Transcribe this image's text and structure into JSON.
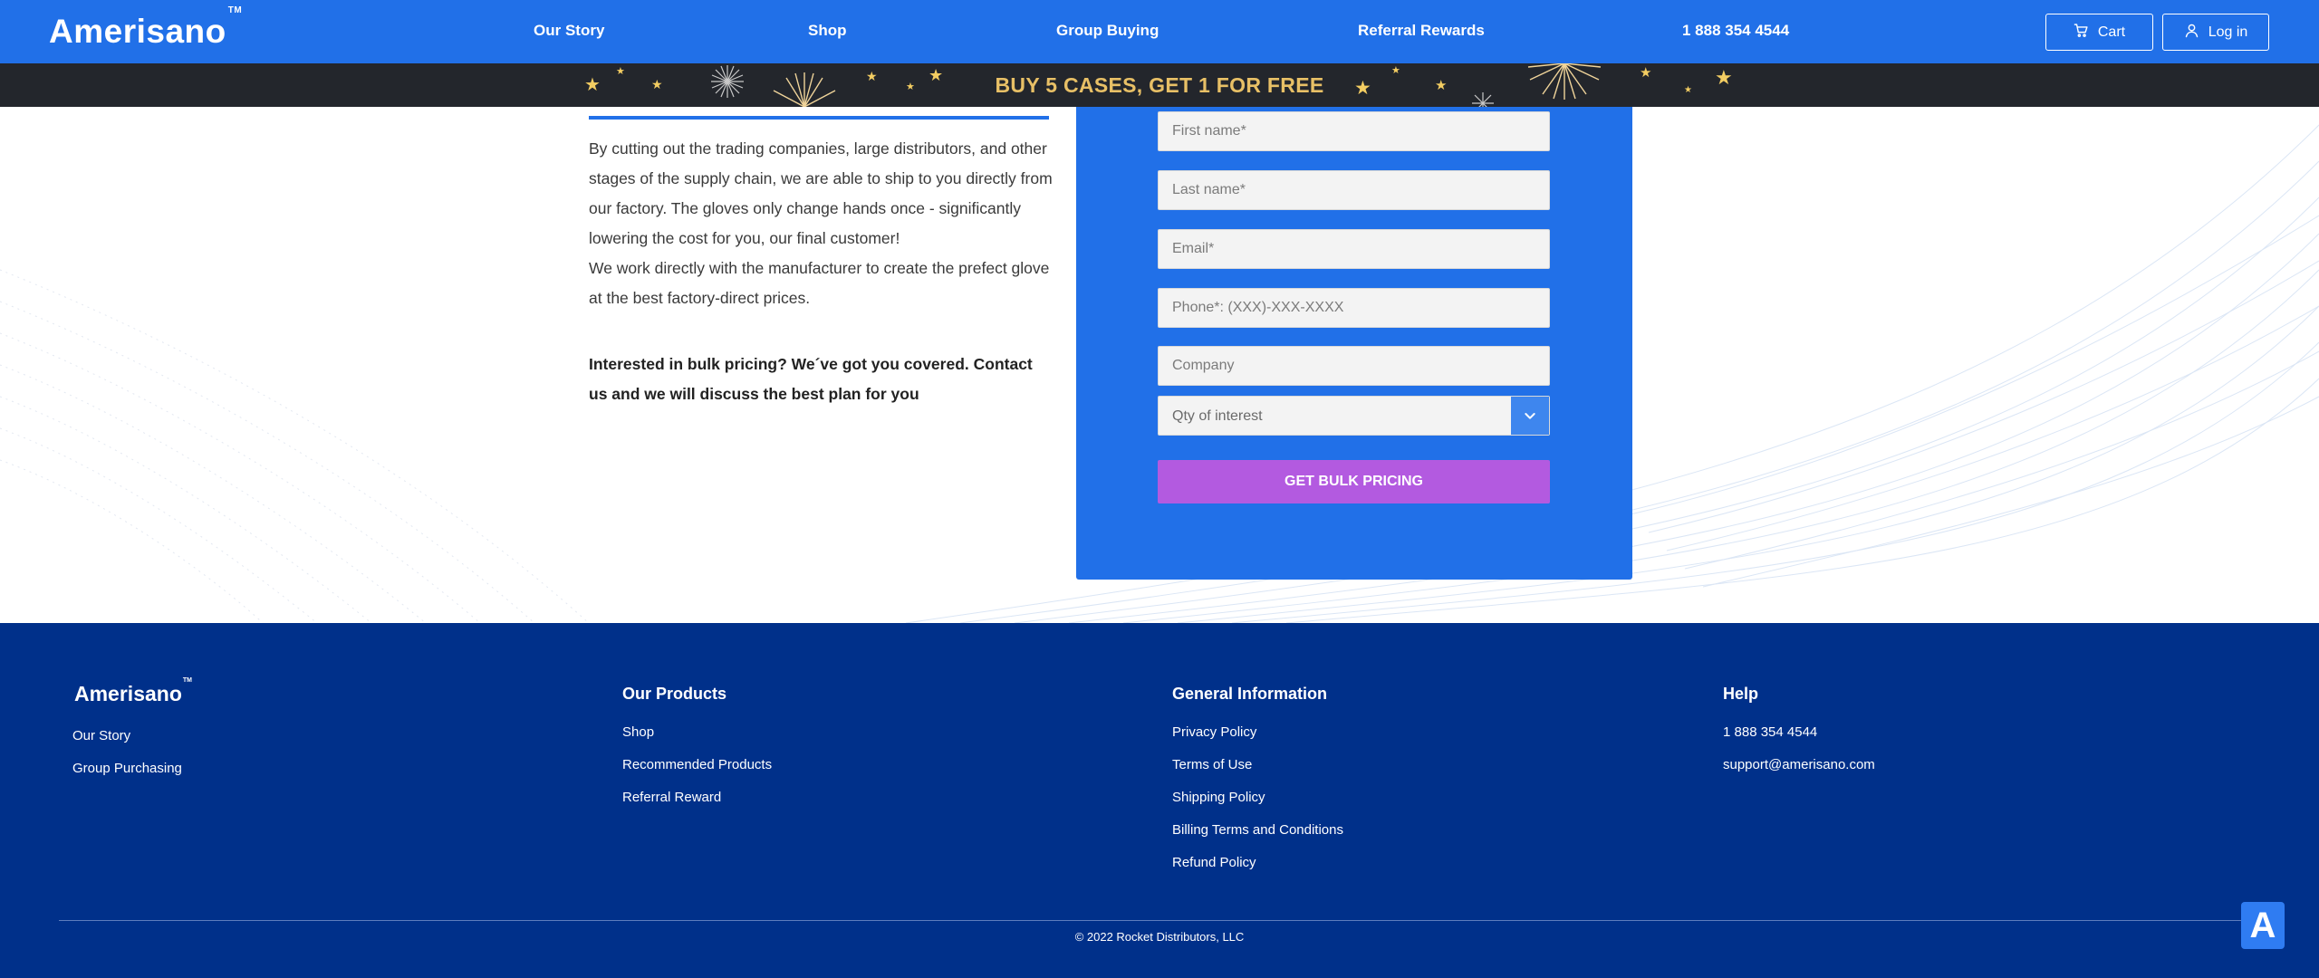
{
  "header": {
    "brand": "Amerisano",
    "brand_tm": "TM",
    "nav": [
      "Our Story",
      "Shop",
      "Group Buying",
      "Referral Rewards",
      "1 888 354 4544"
    ],
    "cart_label": "Cart",
    "login_label": "Log in",
    "cart_icon": "cart-icon",
    "login_icon": "user-icon",
    "background_color": "#2170e8"
  },
  "promo": {
    "text": "BUY 5 CASES, GET 1 FOR FREE",
    "text_color": "#e8c066",
    "background_color": "#23262c"
  },
  "main": {
    "paragraph_1": "By cutting out the trading companies, large distributors, and other stages of the supply chain, we are able to ship to you directly from our factory. The gloves only change hands once - significantly lowering the cost for you, our final customer!",
    "paragraph_2": "We work directly with the manufacturer to create the prefect glove at the best factory-direct prices.",
    "bold_callout": "Interested in bulk pricing? We´ve got you covered. Contact us and we will discuss the best plan for you"
  },
  "form": {
    "first_name_placeholder": "First name*",
    "last_name_placeholder": "Last name*",
    "email_placeholder": "Email*",
    "phone_placeholder": "Phone*: (XXX)-XXX-XXXX",
    "company_placeholder": "Company",
    "qty_label": "Qty of interest",
    "submit_label": "GET BULK PRICING",
    "submit_color": "#b35ae0",
    "panel_color": "#2170e8"
  },
  "footer": {
    "brand": "Amerisano",
    "brand_tm": "TM",
    "col1_links": [
      "Our Story",
      "Group Purchasing"
    ],
    "col2_heading": "Our Products",
    "col2_links": [
      "Shop",
      "Recommended Products",
      "Referral Reward"
    ],
    "col3_heading": "General Information",
    "col3_links": [
      "Privacy Policy",
      "Terms of Use",
      "Shipping Policy",
      "Billing Terms and Conditions",
      "Refund Policy"
    ],
    "col4_heading": "Help",
    "col4_links": [
      "1 888 354 4544",
      "support@amerisano.com"
    ],
    "copyright": "© 2022 Rocket Distributors, LLC",
    "background_color": "#00308a"
  },
  "widget": {
    "badge_label": "A"
  }
}
